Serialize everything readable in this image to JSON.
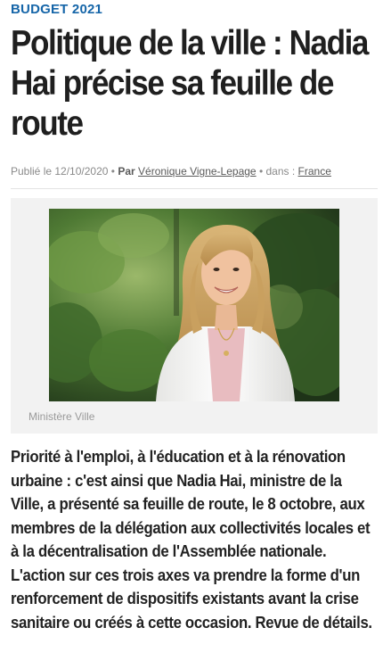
{
  "article": {
    "rubric": "BUDGET 2021",
    "title": "Politique de la ville : Nadia Hai précise sa feuille de route",
    "byline": {
      "published_prefix": "Publié le",
      "date": "12/10/2020",
      "by_label": "Par",
      "author": "Véronique Vigne-Lepage",
      "in_label": "dans :",
      "section": "France"
    },
    "image": {
      "subject": "portrait-photo",
      "credit": "Ministère Ville"
    },
    "lede": "Priorité à l'emploi, à l'éducation et à la rénovation urbaine : c'est ainsi que Nadia Hai, ministre de la Ville, a présenté sa feuille de route, le 8 octobre, aux membres de la délégation aux collectivités locales et à la décentralisation de l'Assemblée nationale. L'action sur ces trois axes va prendre la forme d'un renforcement de dispositifs existants avant la crise sanitaire ou créés à cette occasion. Revue de détails."
  },
  "colors": {
    "rubric": "#1565a8",
    "meta": "#8a8a8a",
    "figure_background": "#f2f2f2"
  }
}
